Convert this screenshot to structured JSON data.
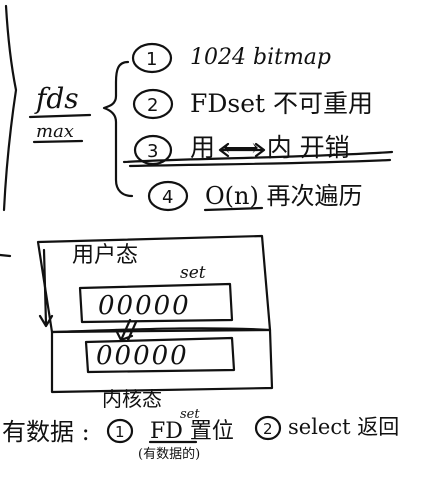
{
  "fds": {
    "title": "fds",
    "subtitle": "max"
  },
  "items": [
    {
      "num": "1",
      "text": "1024 bitmap"
    },
    {
      "num": "2",
      "text": "FDset 不可重用"
    },
    {
      "num": "3",
      "text": "用 ⟷ 内 开销"
    },
    {
      "num": "4",
      "text": "O(n) 再次遍历"
    }
  ],
  "user_space": {
    "label": "用户态",
    "set_label": "set",
    "bits": "00000"
  },
  "kernel_space": {
    "label": "内核态",
    "bits": "00000"
  },
  "bottom": {
    "prefix": "有数据 :",
    "step1_num": "1",
    "step1_text": "FD 置位",
    "step1_sup": "set",
    "step1_note": "(有数据的)",
    "step2_num": "2",
    "step2_text": "select 返回"
  },
  "colors": {
    "ink": "#111111",
    "paper": "#ffffff"
  }
}
